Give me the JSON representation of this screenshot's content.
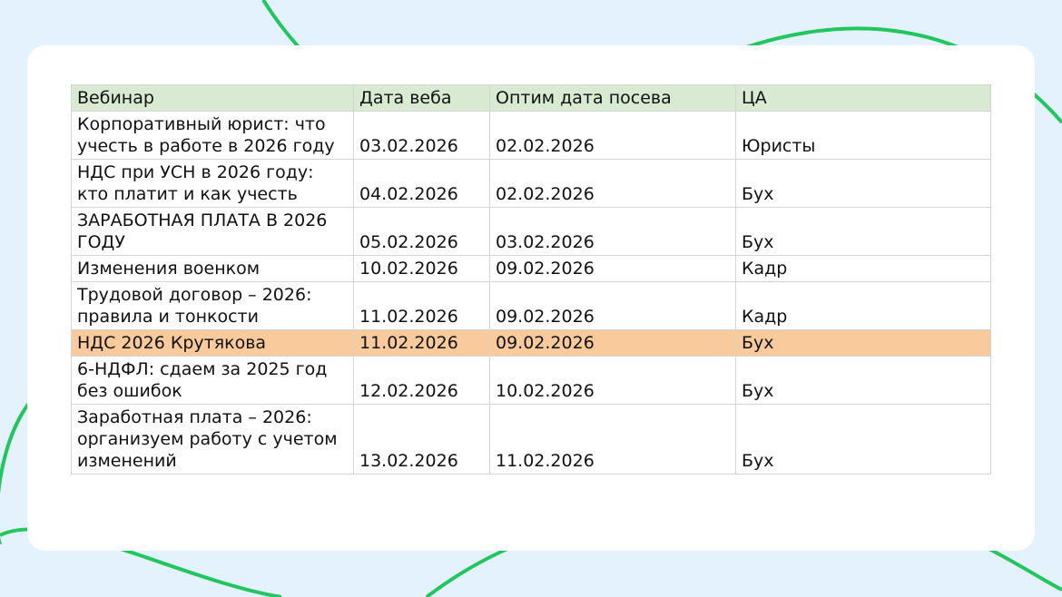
{
  "table": {
    "headers": [
      "Вебинар",
      "Дата веба",
      "Оптим дата посева",
      "ЦА"
    ],
    "rows": [
      {
        "webinar": "Корпоративный юрист: что учесть в работе в 2026 году",
        "date": "03.02.2026",
        "seed_date": "02.02.2026",
        "audience": "Юристы"
      },
      {
        "webinar": "НДС при УСН в 2026 году: кто платит и как учесть",
        "date": "04.02.2026",
        "seed_date": "02.02.2026",
        "audience": "Бух"
      },
      {
        "webinar": "ЗАРАБОТНАЯ ПЛАТА В 2026 ГОДУ",
        "date": "05.02.2026",
        "seed_date": "03.02.2026",
        "audience": "Бух"
      },
      {
        "webinar": "Изменения военком",
        "date": "10.02.2026",
        "seed_date": "09.02.2026",
        "audience": "Кадр"
      },
      {
        "webinar": "Трудовой договор – 2026: правила и тонкости",
        "date": "11.02.2026",
        "seed_date": "09.02.2026",
        "audience": "Кадр"
      },
      {
        "webinar": "НДС 2026 Крутякова",
        "date": "11.02.2026",
        "seed_date": "09.02.2026",
        "audience": "Бух"
      },
      {
        "webinar": "6-НДФЛ: сдаем за 2025 год без ошибок",
        "date": "12.02.2026",
        "seed_date": "10.02.2026",
        "audience": "Бух"
      },
      {
        "webinar": "Заработная плата – 2026: организуем работу с учетом изменений",
        "date": "13.02.2026",
        "seed_date": "11.02.2026",
        "audience": "Бух"
      }
    ]
  },
  "colors": {
    "background": "#e3f2fc",
    "accent_curve": "#22c55e",
    "header_fill": "#d9ead3",
    "highlight_row_fill": "#f9cb9c"
  }
}
